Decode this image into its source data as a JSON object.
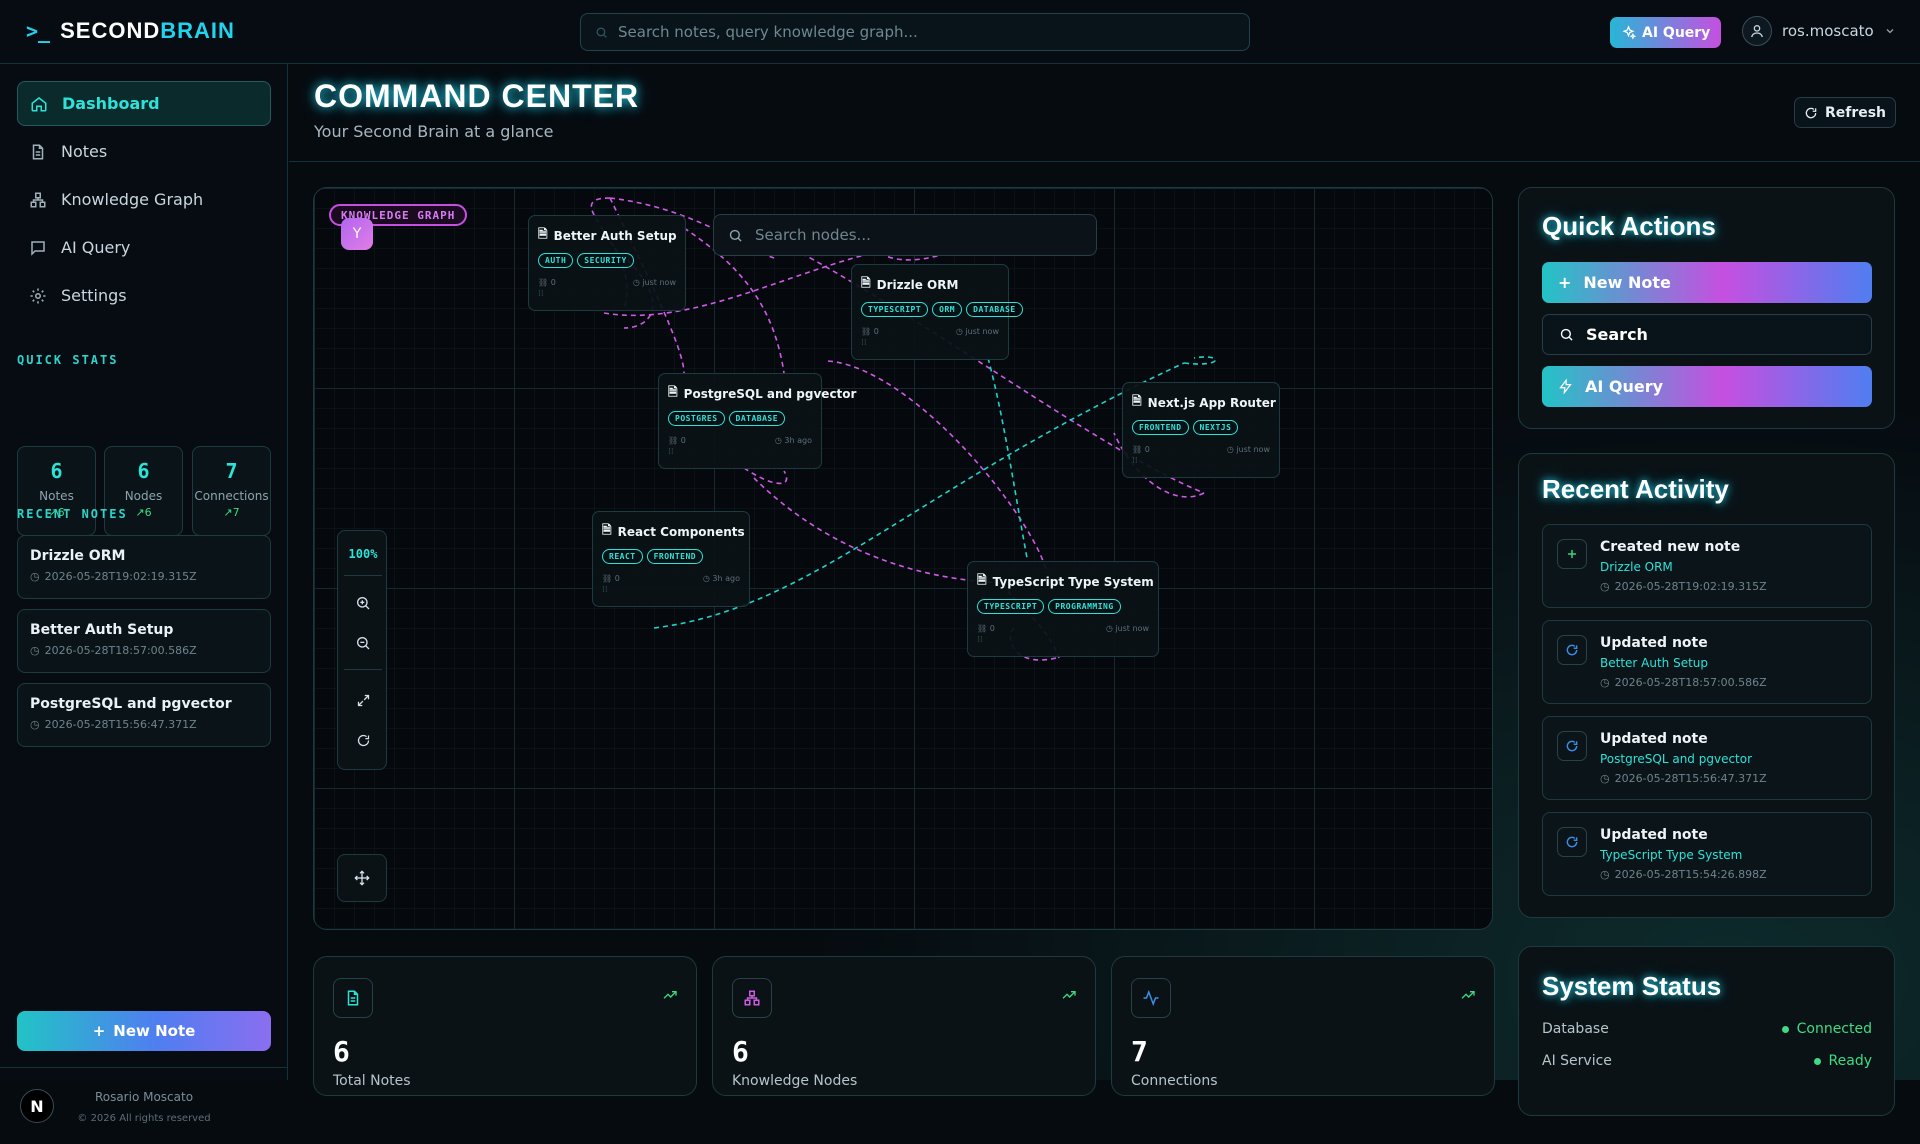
{
  "app": {
    "brand_prompt": ">_",
    "brand_a": "SECOND",
    "brand_b": "BRAIN"
  },
  "topbar": {
    "search_placeholder": "Search notes, query knowledge graph...",
    "ai_query_label": "AI Query",
    "username": "ros.moscato"
  },
  "sidebar": {
    "nav": [
      {
        "label": "Dashboard",
        "icon": "home-icon",
        "active": true
      },
      {
        "label": "Notes",
        "icon": "file-icon"
      },
      {
        "label": "Knowledge Graph",
        "icon": "network-icon"
      },
      {
        "label": "AI Query",
        "icon": "chat-icon"
      },
      {
        "label": "Settings",
        "icon": "gear-icon"
      }
    ],
    "quick_stats_title": "QUICK STATS",
    "stats": [
      {
        "value": "6",
        "label": "Notes",
        "trend": "6"
      },
      {
        "value": "6",
        "label": "Nodes",
        "trend": "6"
      },
      {
        "value": "7",
        "label": "Connections",
        "trend": "7"
      }
    ],
    "recent_title": "RECENT NOTES",
    "recent": [
      {
        "title": "Drizzle ORM",
        "date": "2026-05-28T19:02:19.315Z"
      },
      {
        "title": "Better Auth Setup",
        "date": "2026-05-28T18:57:00.586Z"
      },
      {
        "title": "PostgreSQL and pgvector",
        "date": "2026-05-28T15:56:47.371Z"
      }
    ],
    "new_note_label": "New Note",
    "footer_logo": "N",
    "footer_name": "Rosario Moscato",
    "footer_copy": "© 2026 All rights reserved"
  },
  "header": {
    "title": "COMMAND CENTER",
    "subtitle": "Your Second Brain at a glance",
    "refresh_label": "Refresh"
  },
  "graph": {
    "badge": "KNOWLEDGE GRAPH",
    "search_placeholder": "Search nodes...",
    "zoom": "100%",
    "nodes": [
      {
        "title": "Better Auth Setup",
        "tags": [
          "AUTH",
          "SECURITY"
        ],
        "links": "0",
        "time": "just now"
      },
      {
        "title": "Drizzle ORM",
        "tags": [
          "TYPESCRIPT",
          "ORM",
          "DATABASE"
        ],
        "links": "0",
        "time": "just now"
      },
      {
        "title": "PostgreSQL and pgvector",
        "tags": [
          "POSTGRES",
          "DATABASE"
        ],
        "links": "0",
        "time": "3h ago"
      },
      {
        "title": "Next.js App Router",
        "tags": [
          "FRONTEND",
          "NEXTJS"
        ],
        "links": "0",
        "time": "just now"
      },
      {
        "title": "React Components",
        "tags": [
          "REACT",
          "FRONTEND"
        ],
        "links": "0",
        "time": "3h ago"
      },
      {
        "title": "TypeScript Type System",
        "tags": [
          "TYPESCRIPT",
          "PROGRAMMING"
        ],
        "links": "0",
        "time": "just now"
      }
    ]
  },
  "quick_actions": {
    "title": "Quick Actions",
    "new_note": "New Note",
    "search": "Search",
    "ai_query": "AI Query"
  },
  "activity": {
    "title": "Recent Activity",
    "items": [
      {
        "action": "Created new note",
        "note": "Drizzle ORM",
        "date": "2026-05-28T19:02:19.315Z",
        "icon": "plus-icon"
      },
      {
        "action": "Updated note",
        "note": "Better Auth Setup",
        "date": "2026-05-28T18:57:00.586Z",
        "icon": "refresh-icon"
      },
      {
        "action": "Updated note",
        "note": "PostgreSQL and pgvector",
        "date": "2026-05-28T15:56:47.371Z",
        "icon": "refresh-icon"
      },
      {
        "action": "Updated note",
        "note": "TypeScript Type System",
        "date": "2026-05-28T15:54:26.898Z",
        "icon": "refresh-icon"
      }
    ]
  },
  "system": {
    "title": "System Status",
    "rows": [
      {
        "label": "Database",
        "status": "Connected"
      },
      {
        "label": "AI Service",
        "status": "Ready"
      }
    ]
  },
  "bottom_stats": [
    {
      "value": "6",
      "label": "Total Notes",
      "icon": "file-icon"
    },
    {
      "value": "6",
      "label": "Knowledge Nodes",
      "icon": "network-icon"
    },
    {
      "value": "7",
      "label": "Connections",
      "icon": "activity-icon"
    }
  ],
  "colors": {
    "accent": "#2de2d8",
    "magenta": "#c64fe0",
    "blue": "#4f7ef0",
    "ok": "#3ddc84"
  }
}
